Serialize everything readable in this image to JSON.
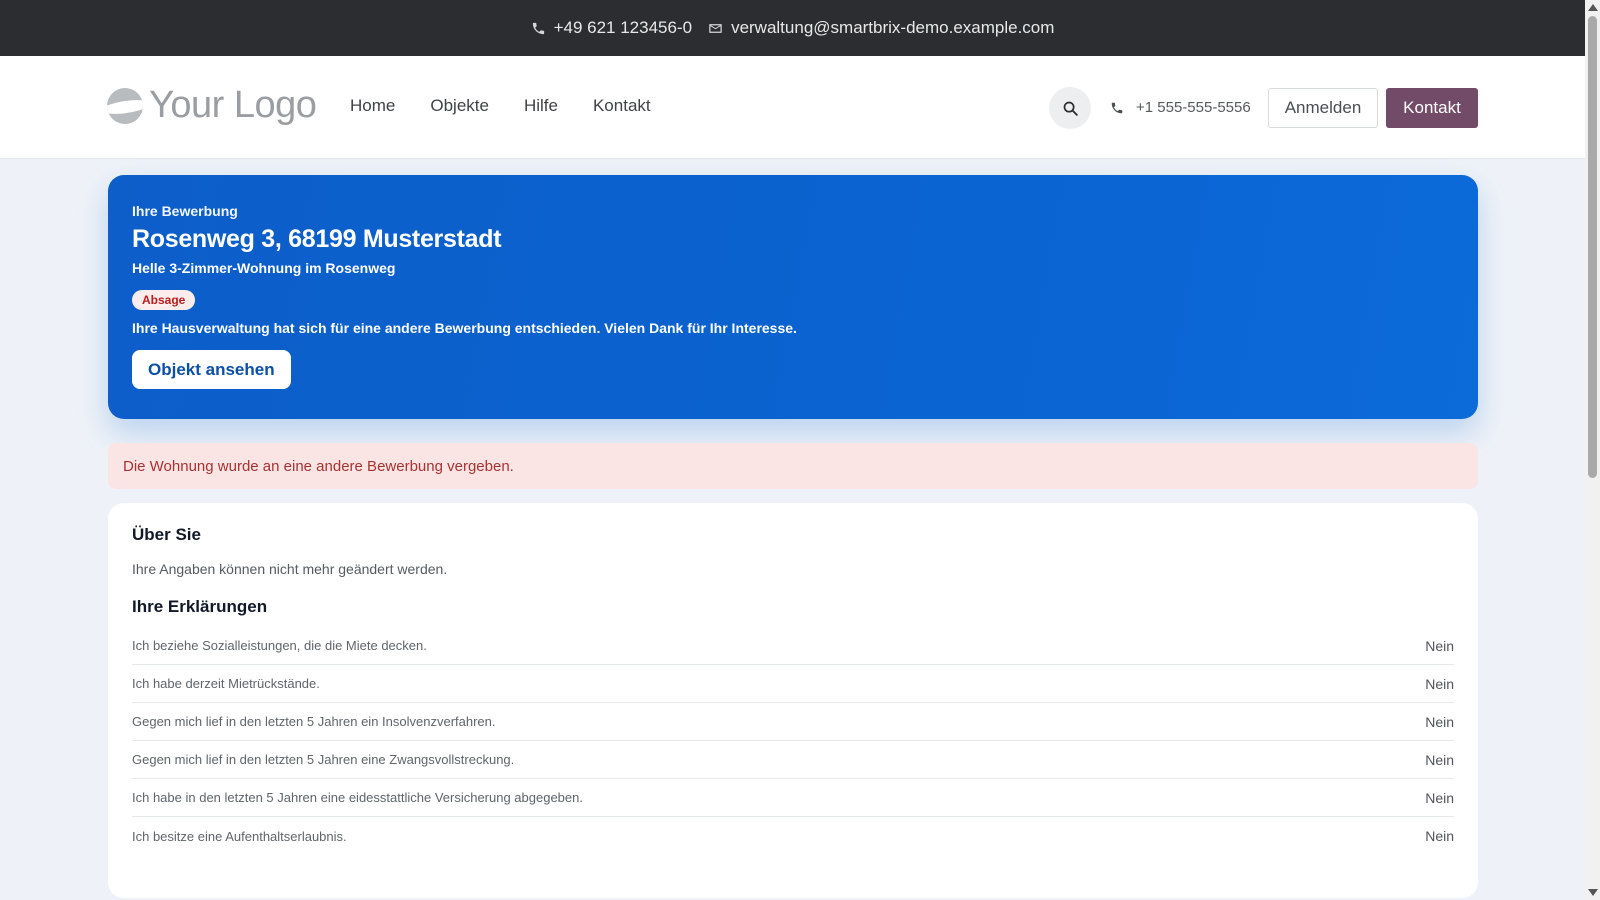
{
  "topbar": {
    "phone": "+49 621 123456-0",
    "email": "verwaltung@smartbrix-demo.example.com"
  },
  "header": {
    "logo_text": "Your Logo",
    "nav": [
      "Home",
      "Objekte",
      "Hilfe",
      "Kontakt"
    ],
    "phone": "+1 555-555-5556",
    "login_label": "Anmelden",
    "contact_label": "Kontakt"
  },
  "hero": {
    "eyebrow": "Ihre Bewerbung",
    "title": "Rosenweg 3, 68199 Musterstadt",
    "subtitle": "Helle 3-Zimmer-Wohnung im Rosenweg",
    "badge": "Absage",
    "message": "Ihre Hausverwaltung hat sich für eine andere Bewerbung entschieden. Vielen Dank für Ihr Interesse.",
    "button_label": "Objekt ansehen"
  },
  "alert": {
    "text": "Die Wohnung wurde an eine andere Bewerbung vergeben."
  },
  "about": {
    "title": "Über Sie",
    "note": "Ihre Angaben können nicht mehr geändert werden.",
    "declarations_title": "Ihre Erklärungen",
    "declarations": [
      {
        "label": "Ich beziehe Sozialleistungen, die die Miete decken.",
        "value": "Nein"
      },
      {
        "label": "Ich habe derzeit Mietrückstände.",
        "value": "Nein"
      },
      {
        "label": "Gegen mich lief in den letzten 5 Jahren ein Insolvenzverfahren.",
        "value": "Nein"
      },
      {
        "label": "Gegen mich lief in den letzten 5 Jahren eine Zwangsvollstreckung.",
        "value": "Nein"
      },
      {
        "label": "Ich habe in den letzten 5 Jahren eine eidesstattliche Versicherung abgegeben.",
        "value": "Nein"
      },
      {
        "label": "Ich besitze eine Aufenthaltserlaubnis.",
        "value": "Nein"
      }
    ]
  },
  "colors": {
    "topbar_bg": "#2b2d30",
    "brand_primary": "#714b67",
    "hero_blue": "#0a63d0",
    "alert_bg": "#fbe5e4",
    "badge_text": "#b91c1c"
  }
}
